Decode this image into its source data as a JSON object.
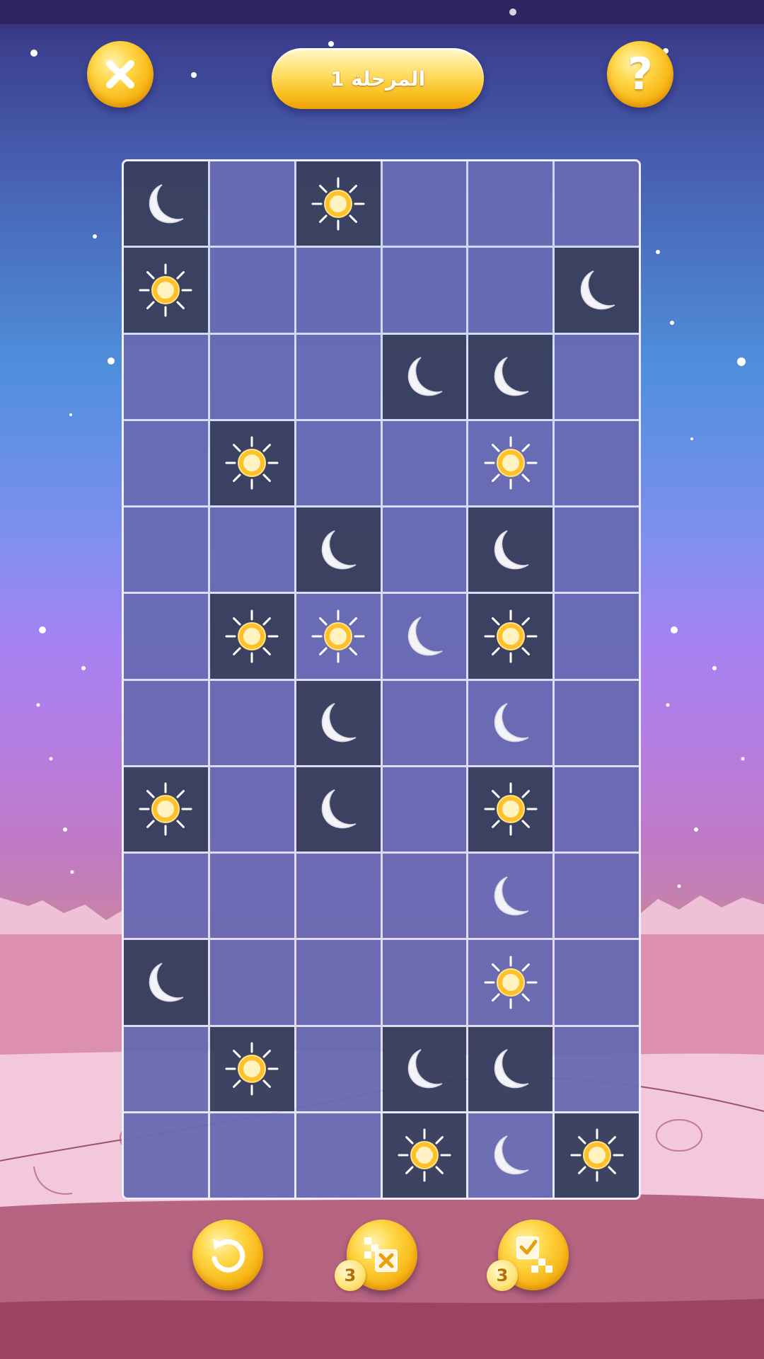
{
  "header": {
    "level_label": "المرحلة 1",
    "help_glyph": "?",
    "close_icon": "close-x-icon",
    "help_icon": "question-mark-icon"
  },
  "board": {
    "columns": 6,
    "rows": 12,
    "legend": {
      "S": "sun",
      "M": "moon",
      "": "empty"
    },
    "cells": [
      [
        {
          "v": "M",
          "locked": true
        },
        {
          "v": "",
          "locked": false
        },
        {
          "v": "S",
          "locked": true
        },
        {
          "v": "",
          "locked": false
        },
        {
          "v": "",
          "locked": false
        },
        {
          "v": "",
          "locked": false
        }
      ],
      [
        {
          "v": "S",
          "locked": true
        },
        {
          "v": "",
          "locked": false
        },
        {
          "v": "",
          "locked": false
        },
        {
          "v": "",
          "locked": false
        },
        {
          "v": "",
          "locked": false
        },
        {
          "v": "M",
          "locked": true
        }
      ],
      [
        {
          "v": "",
          "locked": false
        },
        {
          "v": "",
          "locked": false
        },
        {
          "v": "",
          "locked": false
        },
        {
          "v": "M",
          "locked": true
        },
        {
          "v": "M",
          "locked": true
        },
        {
          "v": "",
          "locked": false
        }
      ],
      [
        {
          "v": "",
          "locked": false
        },
        {
          "v": "S",
          "locked": true
        },
        {
          "v": "",
          "locked": false
        },
        {
          "v": "",
          "locked": false
        },
        {
          "v": "S",
          "locked": false
        },
        {
          "v": "",
          "locked": false
        }
      ],
      [
        {
          "v": "",
          "locked": false
        },
        {
          "v": "",
          "locked": false
        },
        {
          "v": "M",
          "locked": true
        },
        {
          "v": "",
          "locked": false
        },
        {
          "v": "M",
          "locked": true
        },
        {
          "v": "",
          "locked": false
        }
      ],
      [
        {
          "v": "",
          "locked": false
        },
        {
          "v": "S",
          "locked": true
        },
        {
          "v": "S",
          "locked": false
        },
        {
          "v": "M",
          "locked": false
        },
        {
          "v": "S",
          "locked": true
        },
        {
          "v": "",
          "locked": false
        }
      ],
      [
        {
          "v": "",
          "locked": false
        },
        {
          "v": "",
          "locked": false
        },
        {
          "v": "M",
          "locked": true
        },
        {
          "v": "",
          "locked": false
        },
        {
          "v": "M",
          "locked": false
        },
        {
          "v": "",
          "locked": false
        }
      ],
      [
        {
          "v": "S",
          "locked": true
        },
        {
          "v": "",
          "locked": false
        },
        {
          "v": "M",
          "locked": true
        },
        {
          "v": "",
          "locked": false
        },
        {
          "v": "S",
          "locked": true
        },
        {
          "v": "",
          "locked": false
        }
      ],
      [
        {
          "v": "",
          "locked": false
        },
        {
          "v": "",
          "locked": false
        },
        {
          "v": "",
          "locked": false
        },
        {
          "v": "",
          "locked": false
        },
        {
          "v": "M",
          "locked": false
        },
        {
          "v": "",
          "locked": false
        }
      ],
      [
        {
          "v": "M",
          "locked": true
        },
        {
          "v": "",
          "locked": false
        },
        {
          "v": "",
          "locked": false
        },
        {
          "v": "",
          "locked": false
        },
        {
          "v": "S",
          "locked": false
        },
        {
          "v": "",
          "locked": false
        }
      ],
      [
        {
          "v": "",
          "locked": false
        },
        {
          "v": "S",
          "locked": true
        },
        {
          "v": "",
          "locked": false
        },
        {
          "v": "M",
          "locked": true
        },
        {
          "v": "M",
          "locked": true
        },
        {
          "v": "",
          "locked": false
        }
      ],
      [
        {
          "v": "",
          "locked": false
        },
        {
          "v": "",
          "locked": false
        },
        {
          "v": "",
          "locked": false
        },
        {
          "v": "S",
          "locked": true
        },
        {
          "v": "M",
          "locked": false
        },
        {
          "v": "S",
          "locked": true
        }
      ]
    ]
  },
  "footer": {
    "undo_icon": "undo-arrow-icon",
    "hint_x_icon": "grid-x-hint-icon",
    "hint_x_count": "3",
    "hint_check_icon": "grid-check-hint-icon",
    "hint_check_count": "3"
  },
  "colors": {
    "button_gold": "#f7b412",
    "cell_open": "#4a4ca0",
    "cell_locked": "#222848",
    "sun": "#ffc02a",
    "moon": "#f4f4f8"
  }
}
